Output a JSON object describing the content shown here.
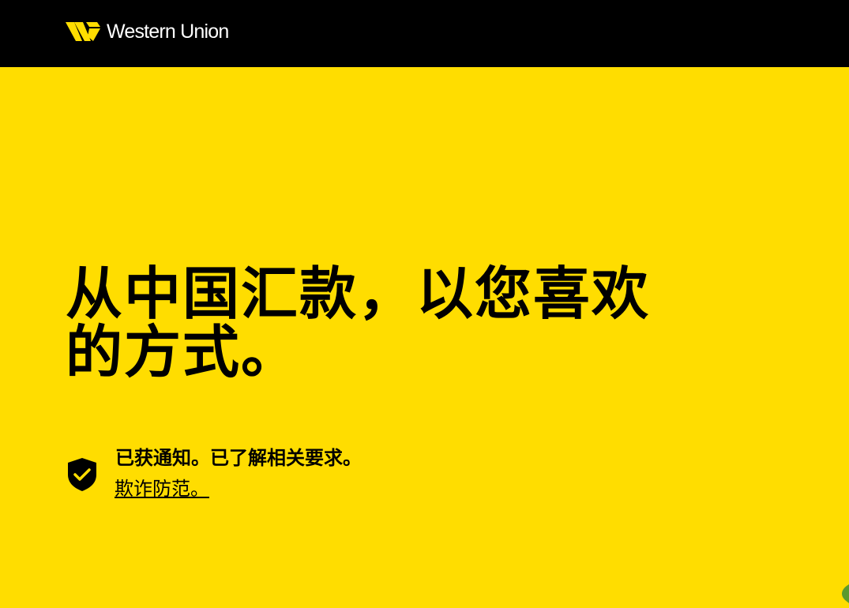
{
  "header": {
    "brand_name": "Western Union",
    "background_color": "#000000",
    "brand_mark_color": "#FFDD00"
  },
  "hero": {
    "background_color": "#FFDD00",
    "headline": "从中国汇款，以您喜欢的方式。",
    "notice": {
      "icon": "shield-check-icon",
      "text": "已获通知。已了解相关要求。",
      "link_label": "欺诈防范。"
    }
  }
}
